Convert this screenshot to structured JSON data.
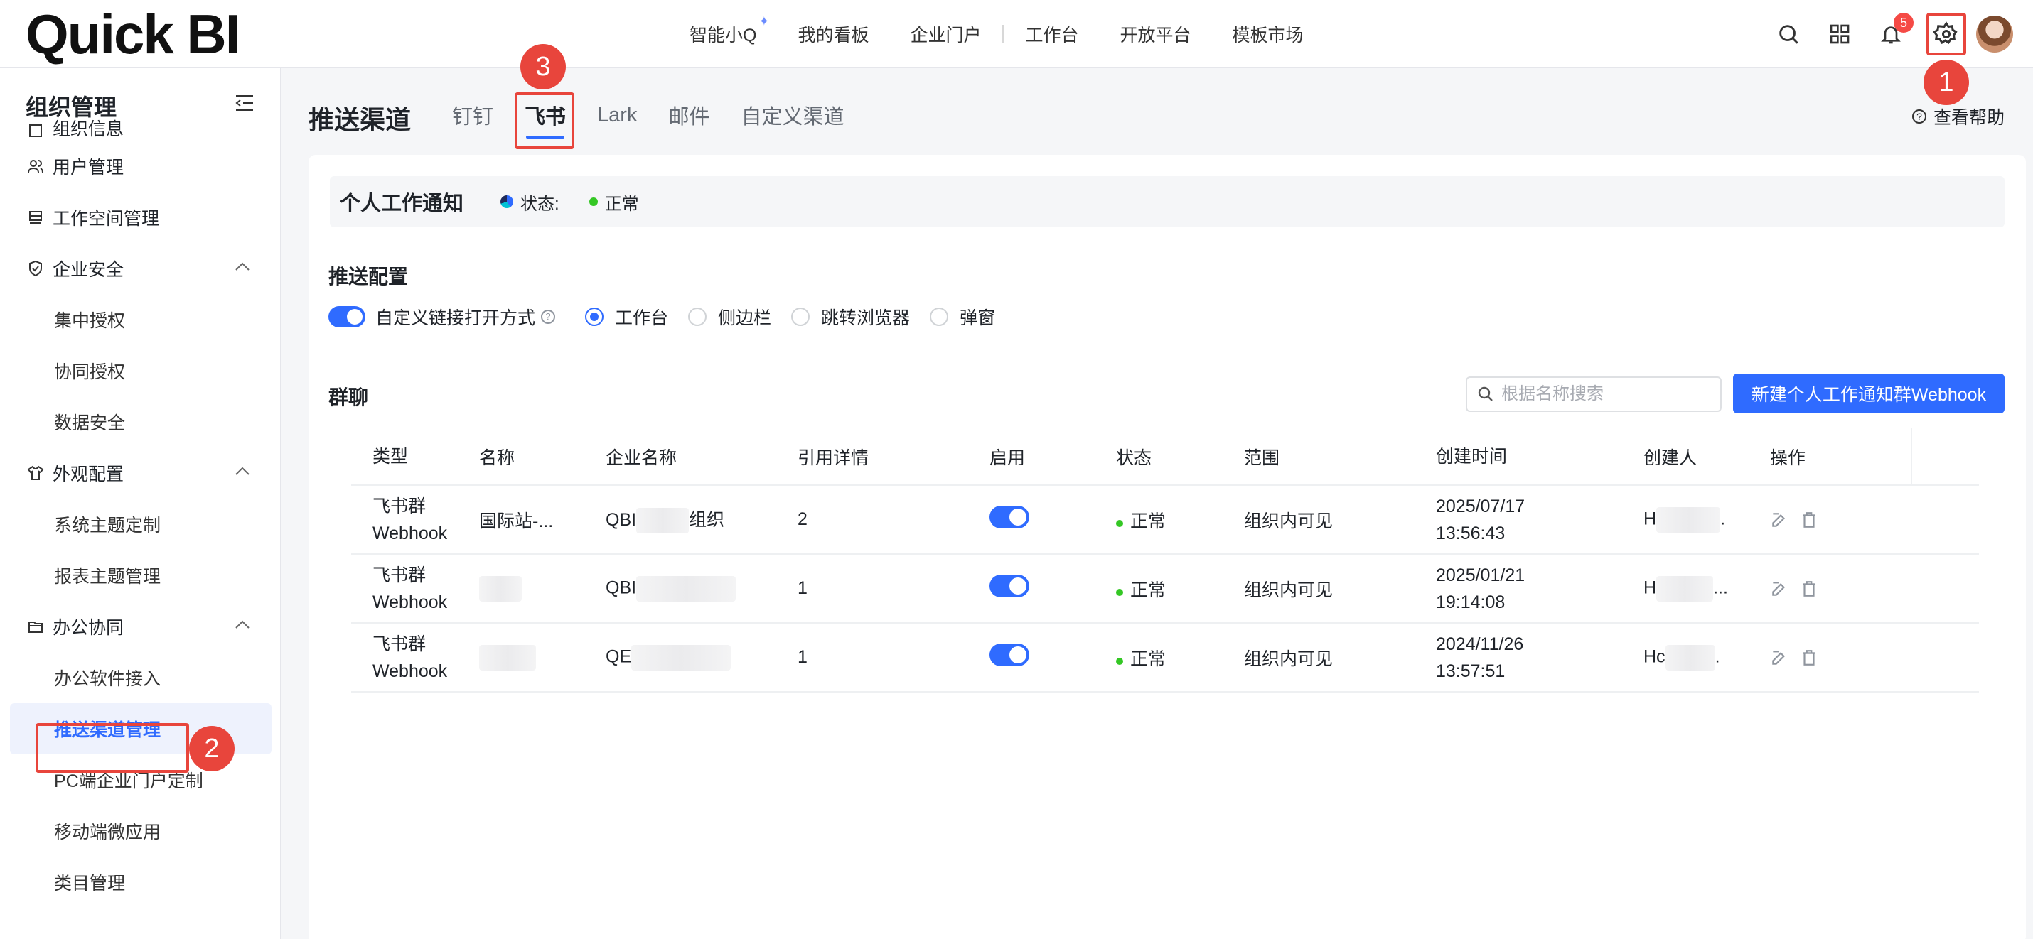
{
  "brand": {
    "logo_text": "Quick BI"
  },
  "topnav": {
    "items": [
      "智能小Q",
      "我的看板",
      "企业门户",
      "工作台",
      "开放平台",
      "模板市场"
    ],
    "notification_count": "5"
  },
  "callouts": [
    "1",
    "2",
    "3"
  ],
  "sidebar": {
    "title": "组织管理",
    "items": [
      {
        "label": "组织信息",
        "icon": "building-icon"
      },
      {
        "label": "用户管理",
        "icon": "users-icon"
      },
      {
        "label": "工作空间管理",
        "icon": "workspace-icon"
      },
      {
        "label": "企业安全",
        "icon": "shield-icon",
        "expanded": true
      },
      {
        "label": "集中授权"
      },
      {
        "label": "协同授权"
      },
      {
        "label": "数据安全"
      },
      {
        "label": "外观配置",
        "icon": "shirt-icon",
        "expanded": true
      },
      {
        "label": "系统主题定制"
      },
      {
        "label": "报表主题管理"
      },
      {
        "label": "办公协同",
        "icon": "folder-icon",
        "expanded": true
      },
      {
        "label": "办公软件接入"
      },
      {
        "label": "推送渠道管理",
        "active": true
      },
      {
        "label": "PC端企业门户定制"
      },
      {
        "label": "移动端微应用"
      },
      {
        "label": "类目管理"
      }
    ]
  },
  "main": {
    "title": "推送渠道",
    "tabs": [
      "钉钉",
      "飞书",
      "Lark",
      "邮件",
      "自定义渠道"
    ],
    "active_tab": "飞书",
    "help_label": "查看帮助",
    "notify": {
      "title": "个人工作通知",
      "status_label": "状态:",
      "status_value": "正常"
    },
    "push_config": {
      "title": "推送配置",
      "toggle_label": "自定义链接打开方式",
      "options": [
        "工作台",
        "侧边栏",
        "跳转浏览器",
        "弹窗"
      ],
      "selected": "工作台"
    },
    "group": {
      "title": "群聊",
      "search_placeholder": "根据名称搜索",
      "new_button": "新建个人工作通知群Webhook",
      "columns": [
        "类型",
        "名称",
        "企业名称",
        "引用详情",
        "启用",
        "状态",
        "范围",
        "创建时间",
        "创建人",
        "操作"
      ],
      "rows": [
        {
          "type_line1": "飞书群",
          "type_line2": "Webhook",
          "name": "国际站-...",
          "company": "QBI",
          "company_tail": "组织",
          "refs": "2",
          "enabled": true,
          "status": "正常",
          "scope": "组织内可见",
          "date": "2025/07/17",
          "time": "13:56:43",
          "creator": "H",
          "creator_tail": "."
        },
        {
          "type_line1": "飞书群",
          "type_line2": "Webhook",
          "name": "",
          "company": "QBI",
          "company_tail": "",
          "refs": "1",
          "enabled": true,
          "status": "正常",
          "scope": "组织内可见",
          "date": "2025/01/21",
          "time": "19:14:08",
          "creator": "H",
          "creator_tail": "..."
        },
        {
          "type_line1": "飞书群",
          "type_line2": "Webhook",
          "name": "",
          "company": "QE",
          "company_tail": "",
          "refs": "1",
          "enabled": true,
          "status": "正常",
          "scope": "组织内可见",
          "date": "2024/11/26",
          "time": "13:57:51",
          "creator": "Hc",
          "creator_tail": "."
        }
      ]
    }
  },
  "colors": {
    "accent": "#2f6bff",
    "callout": "#e8453c",
    "status_ok": "#34c724"
  }
}
